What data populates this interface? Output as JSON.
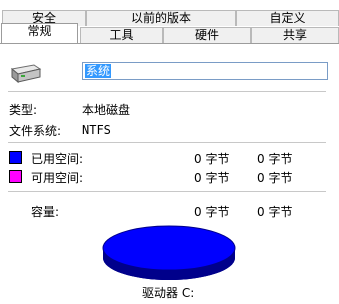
{
  "tabs": {
    "back": [
      "安全",
      "以前的版本",
      "自定义"
    ],
    "front": [
      "常规",
      "工具",
      "硬件",
      "共享"
    ],
    "active": "常规"
  },
  "drive": {
    "icon": "hard-drive-icon",
    "name_value": "系统"
  },
  "info": {
    "type_label": "类型:",
    "type_value": "本地磁盘",
    "fs_label": "文件系统:",
    "fs_value": "NTFS"
  },
  "space": {
    "used": {
      "label": "已用空间:",
      "bytes": "0 字节",
      "size": "0 字节",
      "color": "#0000ff"
    },
    "free": {
      "label": "可用空间:",
      "bytes": "0 字节",
      "size": "0 字节",
      "color": "#ff00ff"
    },
    "capacity": {
      "label": "容量:",
      "bytes": "0 字节",
      "size": "0 字节"
    }
  },
  "pie": {
    "used_fraction": 1.0,
    "fill_color": "#0000ff",
    "side_color": "#00008b"
  },
  "drive_label": "驱动器 C:"
}
